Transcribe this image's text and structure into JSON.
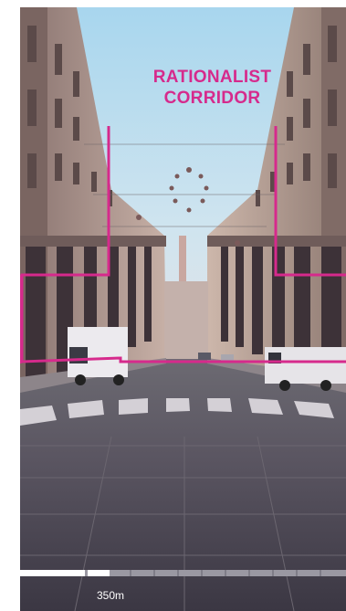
{
  "overlay": {
    "title_line1": "RATIONALIST",
    "title_line2": "CORRIDOR",
    "accent_color": "#d62a8c"
  },
  "scale_bar": {
    "label": "350m"
  }
}
